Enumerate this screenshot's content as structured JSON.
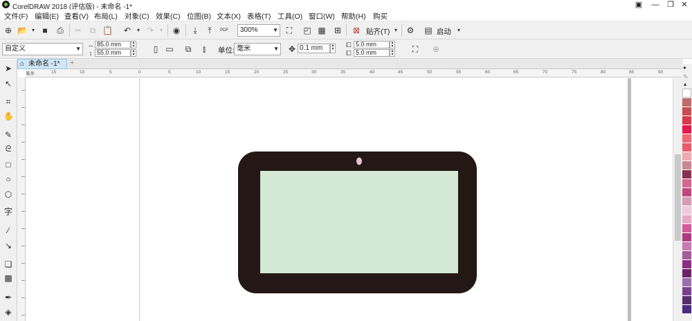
{
  "window": {
    "title": "CorelDRAW 2018 (评估版) - 未命名 -1*"
  },
  "menu": [
    "文件(F)",
    "编辑(E)",
    "查看(V)",
    "布局(L)",
    "对象(C)",
    "效果(C)",
    "位图(B)",
    "文本(X)",
    "表格(T)",
    "工具(O)",
    "窗口(W)",
    "帮助(H)",
    "购买"
  ],
  "toolbar": {
    "zoom": "300%",
    "snap_label": "贴齐(T)",
    "launch_label": "启动"
  },
  "propbar": {
    "preset": "自定义",
    "width": "85.0 mm",
    "height": "55.0 mm",
    "units_label": "单位:",
    "units": "毫米",
    "nudge": "0.1 mm",
    "dup_x": "5.0 mm",
    "dup_y": "5.0 mm"
  },
  "document": {
    "tab": "未命名 -1*"
  },
  "ruler": {
    "h_ticks": [
      "15",
      "10",
      "5",
      "0",
      "5",
      "10",
      "15",
      "20",
      "25",
      "30",
      "35",
      "40",
      "45",
      "50",
      "55",
      "60",
      "65",
      "70",
      "75",
      "80",
      "85",
      "90"
    ],
    "unit": "毫米"
  },
  "canvas": {
    "tablet_color": "#231815",
    "screen_color": "#d3e9d5",
    "camera_color": "#e7bfd4"
  },
  "palette": [
    "#c06a6a",
    "#c94d4d",
    "#d63a4a",
    "#e6194e",
    "#ef6a77",
    "#ea5a6c",
    "#f2a9ae",
    "#c98992",
    "#8a3150",
    "#d6678e",
    "#c2467e",
    "#d89ab5",
    "#f0c9d8",
    "#e8a8c8",
    "#d45a9a",
    "#b03a80",
    "#c97ab6",
    "#a25c98",
    "#8a2f86",
    "#6d2268",
    "#9b6faf",
    "#7a3f8f",
    "#5a2e6e",
    "#4f2b82"
  ],
  "icons": {
    "home": "home-icon",
    "settings": "gear-icon",
    "snap": "magnet-icon"
  }
}
